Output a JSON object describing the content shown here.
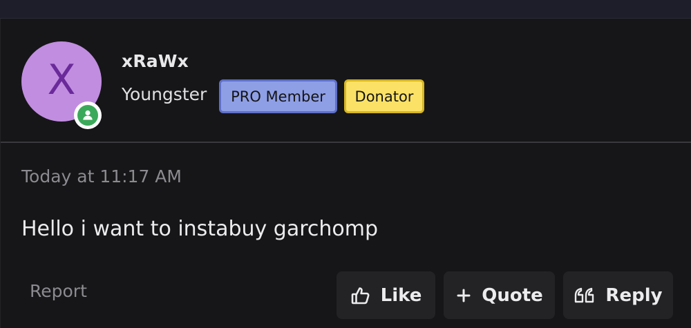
{
  "user": {
    "avatar_letter": "X",
    "avatar_color": "#c18de0",
    "online_status_icon": "user-online-icon",
    "name": "xRaWx",
    "title": "Youngster",
    "badges": [
      {
        "label": "PRO Member",
        "color": "#8f9fe6"
      },
      {
        "label": "Donator",
        "color": "#fbe266"
      }
    ]
  },
  "post": {
    "timestamp": "Today at 11:17 AM",
    "message": "Hello i want to instabuy garchomp"
  },
  "actions": {
    "report_label": "Report",
    "like_label": "Like",
    "like_icon": "thumbs-up-icon",
    "quote_label": "Quote",
    "quote_icon": "plus-icon",
    "reply_label": "Reply",
    "reply_icon": "quote-marks-icon"
  }
}
